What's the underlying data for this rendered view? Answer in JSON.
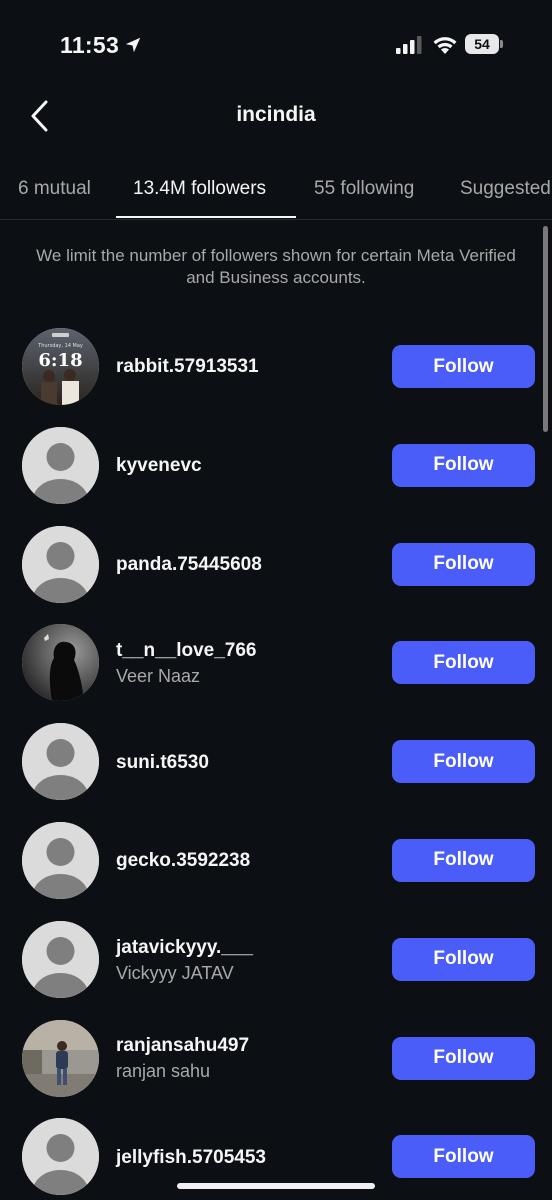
{
  "status_bar": {
    "time": "11:53",
    "battery": "54",
    "icons": [
      "location-arrow-icon",
      "cellular-signal-icon",
      "wifi-icon",
      "battery-icon"
    ]
  },
  "header": {
    "title": "incindia",
    "back_icon": "chevron-left-icon"
  },
  "tabs": [
    {
      "label": "6 mutual",
      "active": false
    },
    {
      "label": "13.4M followers",
      "active": true
    },
    {
      "label": "55 following",
      "active": false
    },
    {
      "label": "Suggested",
      "active": false
    }
  ],
  "notice": "We limit the number of followers shown for certain Meta Verified and Business accounts.",
  "follow_label": "Follow",
  "followers": [
    {
      "username": "rabbit.57913531",
      "full_name": "",
      "avatar": "lockscreen-photo"
    },
    {
      "username": "kyvenevc",
      "full_name": "",
      "avatar": "default"
    },
    {
      "username": "panda.75445608",
      "full_name": "",
      "avatar": "default"
    },
    {
      "username": "t__n__love_766",
      "full_name": "Veer Naaz",
      "avatar": "silhouette-photo"
    },
    {
      "username": "suni.t6530",
      "full_name": "",
      "avatar": "default"
    },
    {
      "username": "gecko.3592238",
      "full_name": "",
      "avatar": "default"
    },
    {
      "username": "jatavickyyy.___",
      "full_name": "Vickyyy JATAV",
      "avatar": "default"
    },
    {
      "username": "ranjansahu497",
      "full_name": "ranjan sahu",
      "avatar": "street-photo"
    },
    {
      "username": "jellyfish.5705453",
      "full_name": "",
      "avatar": "default"
    }
  ],
  "avatar_lockscreen_text": {
    "day": "Thursday, 14 May",
    "time": "6:18"
  },
  "colors": {
    "background": "#0c1014",
    "follow_button": "#4a5df9",
    "secondary_text": "#a8a8a8",
    "primary_text": "#f5f5f5"
  }
}
